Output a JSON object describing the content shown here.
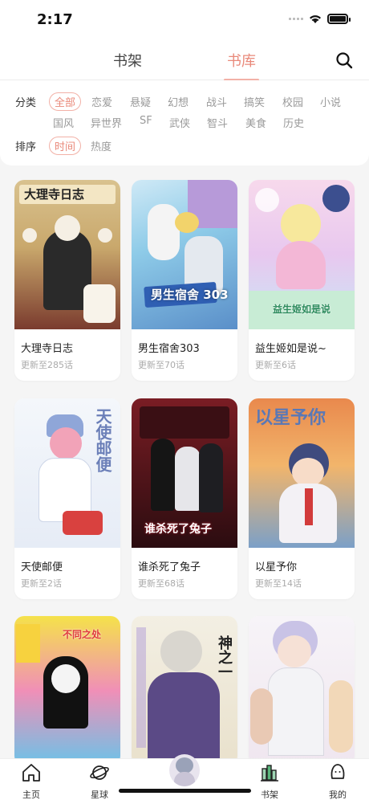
{
  "status": {
    "time": "2:17"
  },
  "tabs": [
    {
      "label": "书架"
    },
    {
      "label": "书库"
    }
  ],
  "filters": {
    "category_label": "分类",
    "categories": [
      "全部",
      "恋爱",
      "悬疑",
      "幻想",
      "战斗",
      "搞笑",
      "校园",
      "小说",
      "国风",
      "异世界",
      "SF",
      "武侠",
      "智斗",
      "美食",
      "历史"
    ],
    "sort_label": "排序",
    "sorts": [
      "时间",
      "热度"
    ]
  },
  "books": [
    {
      "title": "大理寺日志",
      "update": "更新至285话",
      "cover_text": "大理寺日志"
    },
    {
      "title": "男生宿舍303",
      "update": "更新至70话",
      "cover_text": "男生宿舍 303"
    },
    {
      "title": "益生姬如是说~",
      "update": "更新至6话",
      "cover_text": "益生姬如是说"
    },
    {
      "title": "天使邮便",
      "update": "更新至2话",
      "cover_text": "天使邮便"
    },
    {
      "title": "谁杀死了兔子",
      "update": "更新至68话",
      "cover_text": "谁杀死了兔子"
    },
    {
      "title": "以星予你",
      "update": "更新至14话",
      "cover_text": "以星予你"
    },
    {
      "title": "",
      "update": "",
      "cover_text": "不同之处"
    },
    {
      "title": "",
      "update": "",
      "cover_text": "神之一"
    },
    {
      "title": "",
      "update": "",
      "cover_text": ""
    }
  ],
  "bottom_nav": [
    {
      "label": "主页",
      "icon": "home-icon"
    },
    {
      "label": "星球",
      "icon": "planet-icon"
    },
    {
      "label": "",
      "icon": "avatar"
    },
    {
      "label": "书架",
      "icon": "bookshelf-icon"
    },
    {
      "label": "我的",
      "icon": "profile-icon"
    }
  ],
  "colors": {
    "accent": "#e9897a",
    "accent_light": "#f2b1a7",
    "muted": "#9a9a9a"
  }
}
